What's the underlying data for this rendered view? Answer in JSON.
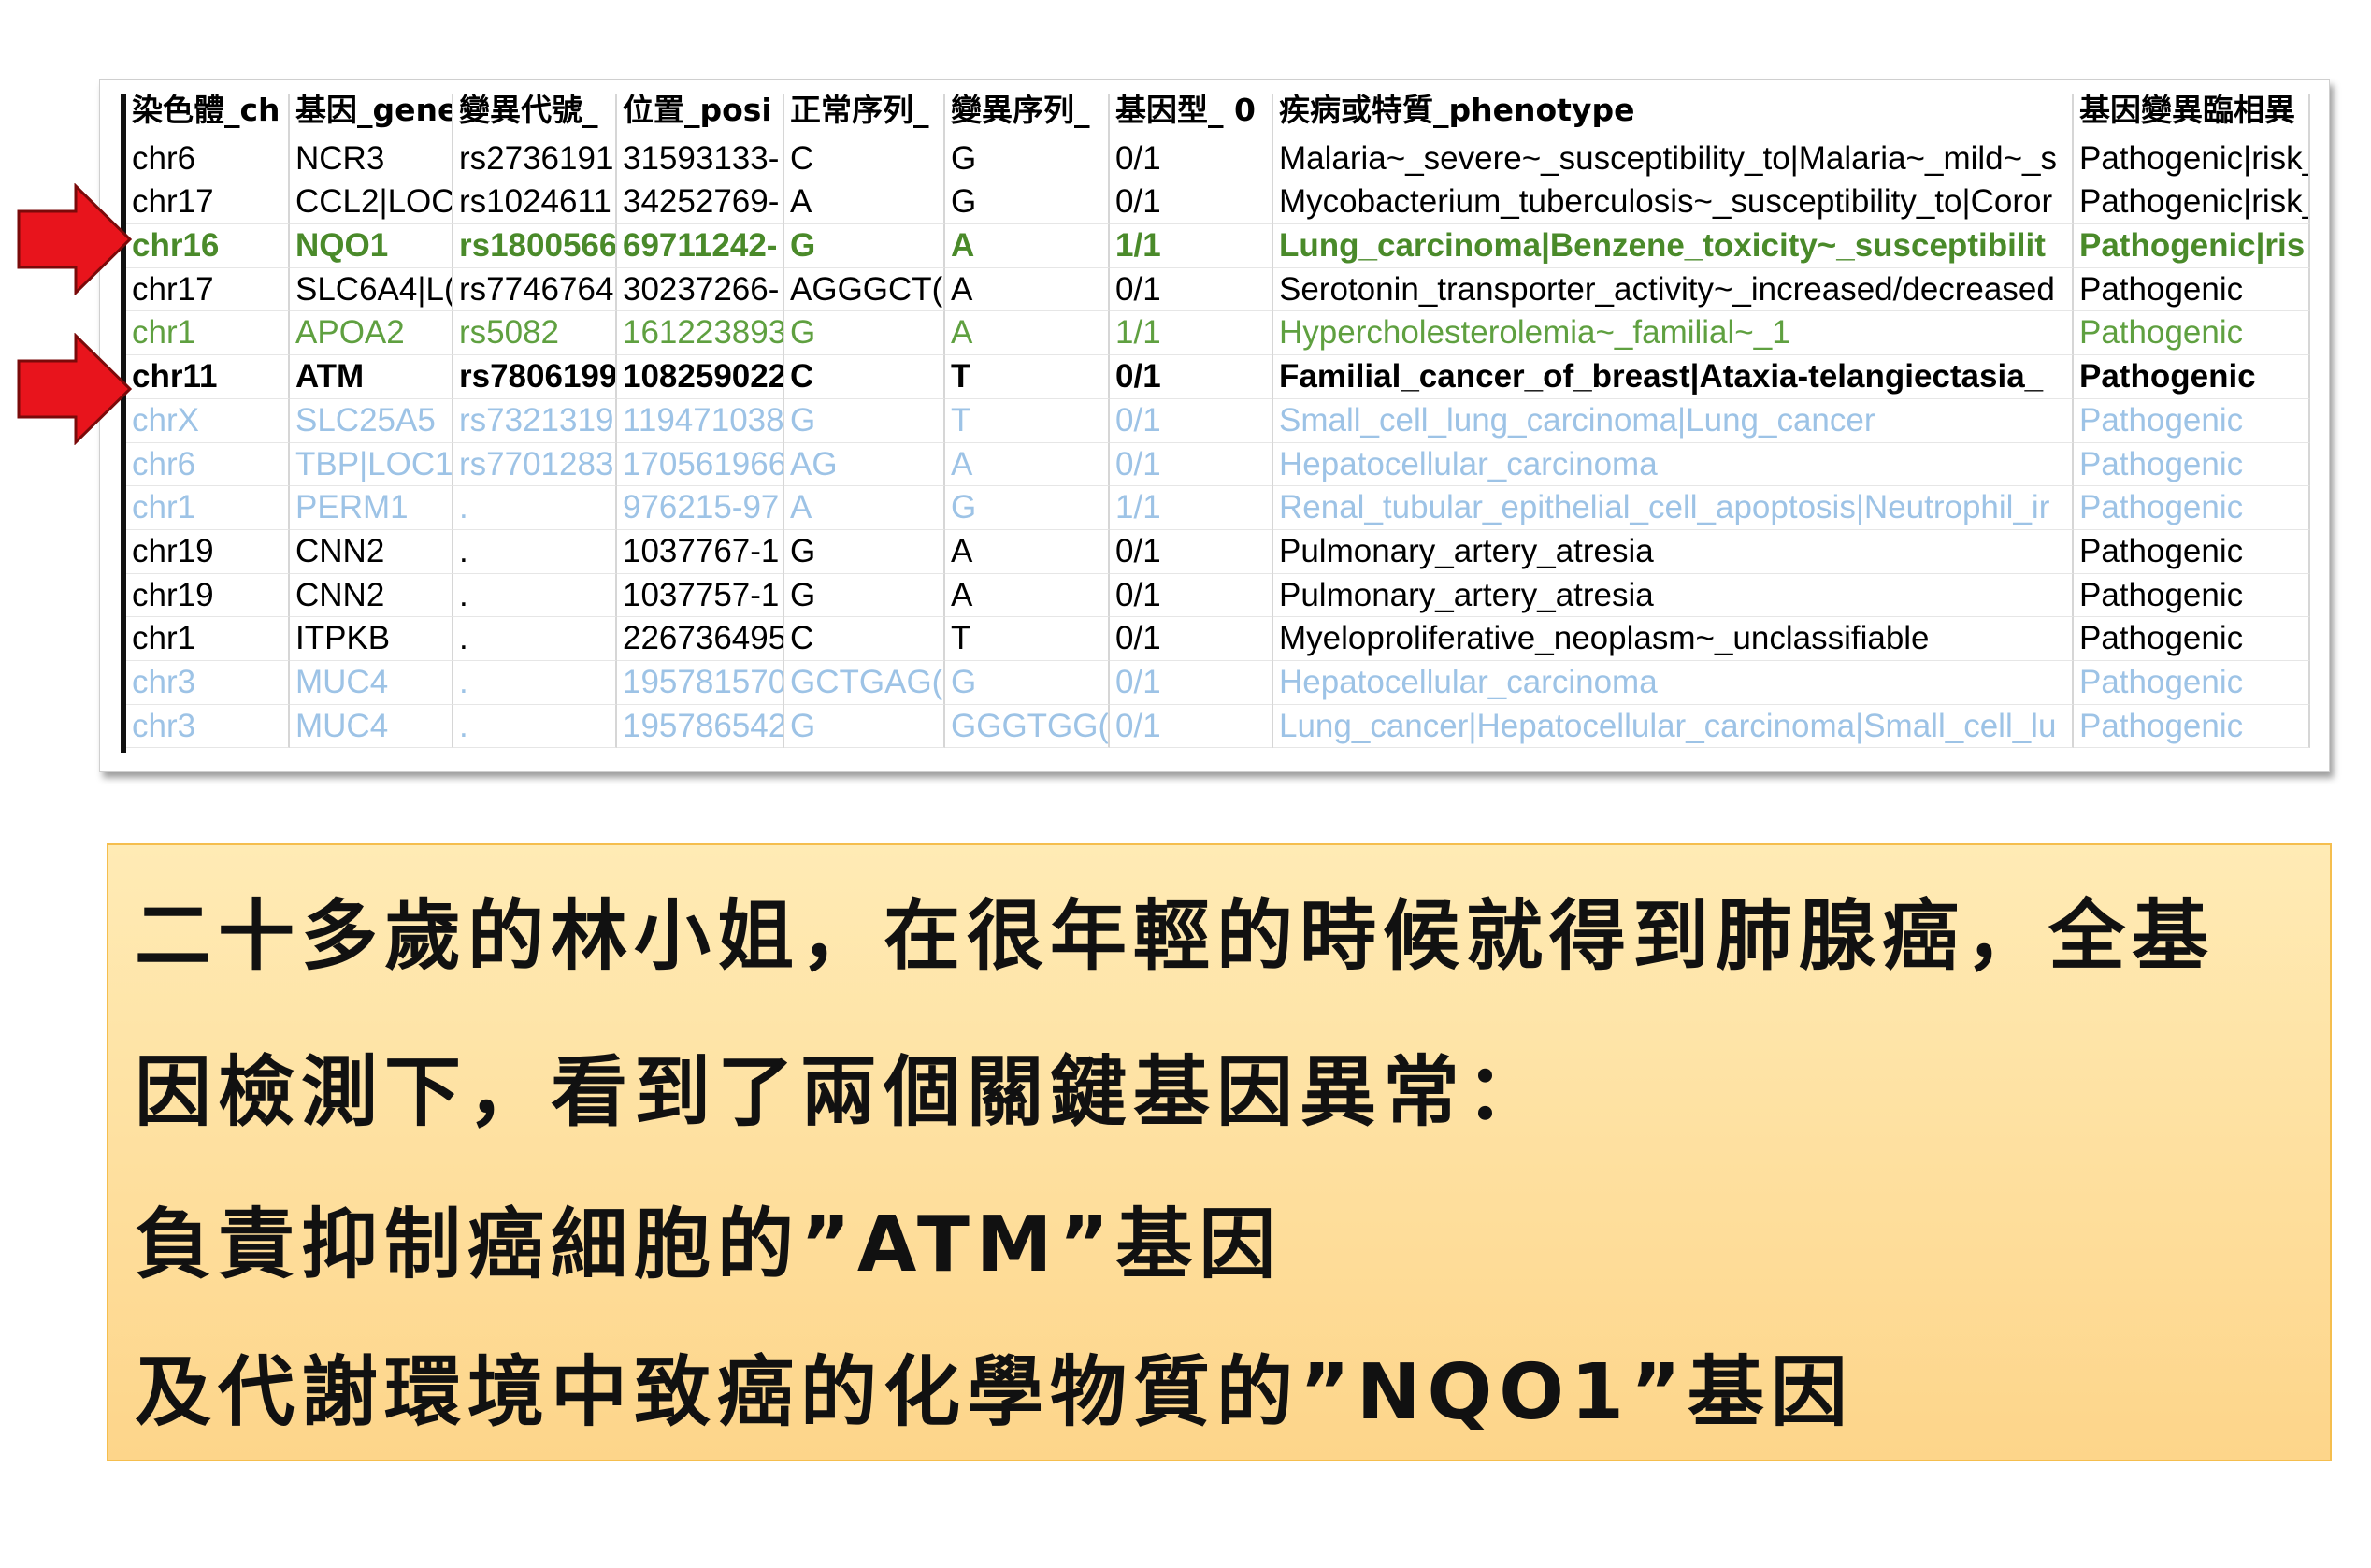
{
  "colors": {
    "text": "#000000",
    "green_bold": "#4A8A2A",
    "green": "#5FA040",
    "muted": "#9DC3E6",
    "arrow": "#E8141C",
    "arrow_edge": "#7A0A0A",
    "note_top": "#FFEBB5",
    "note_bottom": "#FDD58A",
    "note_border": "#F5BE4E"
  },
  "table": {
    "headers": [
      "染色體_ch",
      "基因_gene",
      "變異代號_",
      "位置_posi",
      "正常序列_",
      "變異序列_",
      "基因型_ 0",
      "疾病或特質_phenotype",
      "基因變異臨相異"
    ],
    "rows": [
      {
        "emphasis": "normal",
        "cells": [
          "chr6",
          "NCR3",
          "rs2736191",
          "31593133-",
          "C",
          "G",
          "0/1",
          "Malaria~_severe~_susceptibility_to|Malaria~_mild~_s",
          "Pathogenic|risk_"
        ]
      },
      {
        "emphasis": "normal",
        "cells": [
          "chr17",
          "CCL2|LOC",
          "rs1024611",
          "34252769-",
          "A",
          "G",
          "0/1",
          "Mycobacterium_tuberculosis~_susceptibility_to|Coror",
          "Pathogenic|risk_"
        ]
      },
      {
        "emphasis": "bold-green",
        "cells": [
          "chr16",
          "NQO1",
          "rs1800566",
          "69711242-",
          "G",
          "A",
          "1/1",
          "Lung_carcinoma|Benzene_toxicity~_susceptibilit",
          "Pathogenic|ris"
        ]
      },
      {
        "emphasis": "normal",
        "cells": [
          "chr17",
          "SLC6A4|L(",
          "rs7746764",
          "30237266-",
          "AGGGCT(",
          "A",
          "0/1",
          "Serotonin_transporter_activity~_increased/decreased",
          "Pathogenic"
        ]
      },
      {
        "emphasis": "green",
        "cells": [
          "chr1",
          "APOA2",
          "rs5082",
          "161223893",
          "G",
          "A",
          "1/1",
          "Hypercholesterolemia~_familial~_1",
          "Pathogenic"
        ]
      },
      {
        "emphasis": "bold",
        "cells": [
          "chr11",
          "ATM",
          "rs7806199",
          "108259022",
          "C",
          "T",
          "0/1",
          "Familial_cancer_of_breast|Ataxia-telangiectasia_",
          "Pathogenic"
        ]
      },
      {
        "emphasis": "muted",
        "cells": [
          "chrX",
          "SLC25A5",
          "rs7321319",
          "119471038",
          "G",
          "T",
          "0/1",
          "Small_cell_lung_carcinoma|Lung_cancer",
          "Pathogenic"
        ]
      },
      {
        "emphasis": "muted",
        "cells": [
          "chr6",
          "TBP|LOC1",
          "rs7701283",
          "170561966",
          "AG",
          "A",
          "0/1",
          "Hepatocellular_carcinoma",
          "Pathogenic"
        ]
      },
      {
        "emphasis": "muted",
        "cells": [
          "chr1",
          "PERM1",
          ".",
          "976215-97",
          "A",
          "G",
          "1/1",
          "Renal_tubular_epithelial_cell_apoptosis|Neutrophil_ir",
          "Pathogenic"
        ]
      },
      {
        "emphasis": "normal",
        "cells": [
          "chr19",
          "CNN2",
          ".",
          "1037767-1",
          "G",
          "A",
          "0/1",
          "Pulmonary_artery_atresia",
          "Pathogenic"
        ]
      },
      {
        "emphasis": "normal",
        "cells": [
          "chr19",
          "CNN2",
          ".",
          "1037757-1",
          "G",
          "A",
          "0/1",
          "Pulmonary_artery_atresia",
          "Pathogenic"
        ]
      },
      {
        "emphasis": "normal",
        "cells": [
          "chr1",
          "ITPKB",
          ".",
          "226736495",
          "C",
          "T",
          "0/1",
          "Myeloproliferative_neoplasm~_unclassifiable",
          "Pathogenic"
        ]
      },
      {
        "emphasis": "muted",
        "cells": [
          "chr3",
          "MUC4",
          ".",
          "195781570",
          "GCTGAG(",
          "G",
          "0/1",
          "Hepatocellular_carcinoma",
          "Pathogenic"
        ]
      },
      {
        "emphasis": "muted",
        "cells": [
          "chr3",
          "MUC4",
          ".",
          "195786542",
          "G",
          "GGGTGG(",
          "0/1",
          "Lung_cancer|Hepatocellular_carcinoma|Small_cell_lu",
          "Pathogenic"
        ]
      }
    ]
  },
  "arrows": {
    "icon": "red-right-arrow",
    "points_to_rows": [
      "chr16",
      "chr11"
    ]
  },
  "caption": {
    "lines": [
      "二十多歲的林小姐，在很年輕的時候就得到肺腺癌，全基",
      "因檢測下，看到了兩個關鍵基因異常：",
      "負責抑制癌細胞的”ATM”基因",
      "及代謝環境中致癌的化學物質的”NQO1”基因"
    ]
  }
}
